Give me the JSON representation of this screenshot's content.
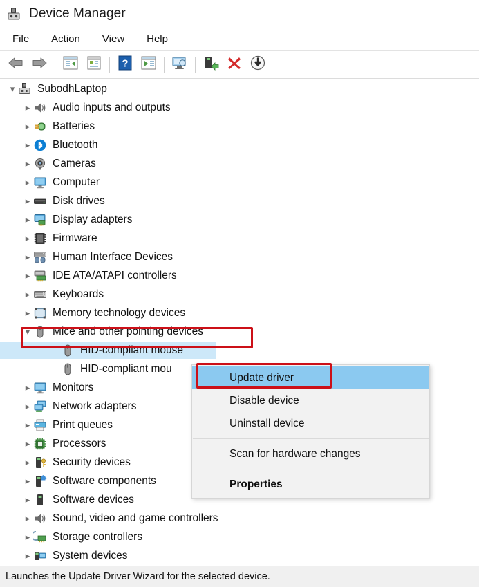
{
  "window": {
    "title": "Device Manager",
    "app_icon": "device-manager-icon"
  },
  "menubar": {
    "items": [
      {
        "label": "File",
        "name": "menu-file"
      },
      {
        "label": "Action",
        "name": "menu-action"
      },
      {
        "label": "View",
        "name": "menu-view"
      },
      {
        "label": "Help",
        "name": "menu-help"
      }
    ]
  },
  "toolbar": {
    "buttons": [
      {
        "icon": "back-arrow-icon",
        "name": "toolbar-back"
      },
      {
        "icon": "forward-arrow-icon",
        "name": "toolbar-forward"
      },
      {
        "icon": "show-hide-console-tree-icon",
        "name": "toolbar-console-tree"
      },
      {
        "icon": "properties-icon",
        "name": "toolbar-properties"
      },
      {
        "icon": "help-icon",
        "name": "toolbar-help"
      },
      {
        "icon": "show-hide-action-pane-icon",
        "name": "toolbar-action-pane"
      },
      {
        "icon": "scan-for-hardware-changes-icon",
        "name": "toolbar-scan-hardware"
      },
      {
        "icon": "update-driver-icon",
        "name": "toolbar-update-driver"
      },
      {
        "icon": "uninstall-device-icon",
        "name": "toolbar-uninstall-device"
      },
      {
        "icon": "disable-device-icon",
        "name": "toolbar-disable-device"
      }
    ]
  },
  "tree": {
    "root": {
      "label": "SubodhLaptop",
      "icon": "computer-root-icon",
      "expanded": true
    },
    "nodes": [
      {
        "label": "Audio inputs and outputs",
        "icon": "speaker-icon",
        "expanded": false,
        "level": 1
      },
      {
        "label": "Batteries",
        "icon": "battery-icon",
        "expanded": false,
        "level": 1
      },
      {
        "label": "Bluetooth",
        "icon": "bluetooth-icon",
        "expanded": false,
        "level": 1
      },
      {
        "label": "Cameras",
        "icon": "camera-icon",
        "expanded": false,
        "level": 1
      },
      {
        "label": "Computer",
        "icon": "monitor-icon",
        "expanded": false,
        "level": 1
      },
      {
        "label": "Disk drives",
        "icon": "disk-drive-icon",
        "expanded": false,
        "level": 1
      },
      {
        "label": "Display adapters",
        "icon": "display-adapter-icon",
        "expanded": false,
        "level": 1
      },
      {
        "label": "Firmware",
        "icon": "firmware-chip-icon",
        "expanded": false,
        "level": 1
      },
      {
        "label": "Human Interface Devices",
        "icon": "hid-icon",
        "expanded": false,
        "level": 1
      },
      {
        "label": "IDE ATA/ATAPI controllers",
        "icon": "ide-controller-icon",
        "expanded": false,
        "level": 1
      },
      {
        "label": "Keyboards",
        "icon": "keyboard-icon",
        "expanded": false,
        "level": 1
      },
      {
        "label": "Memory technology devices",
        "icon": "memory-technology-icon",
        "expanded": false,
        "level": 1
      },
      {
        "label": "Mice and other pointing devices",
        "icon": "mouse-icon",
        "expanded": true,
        "level": 1,
        "highlighted": true
      },
      {
        "label": "HID-compliant mouse",
        "icon": "mouse-icon",
        "level": 2,
        "selected": true
      },
      {
        "label": "HID-compliant mouse",
        "icon": "mouse-icon",
        "level": 2,
        "clipped_label": "HID-compliant mou"
      },
      {
        "label": "Monitors",
        "icon": "monitor-icon",
        "expanded": false,
        "level": 1
      },
      {
        "label": "Network adapters",
        "icon": "network-adapter-icon",
        "expanded": false,
        "level": 1
      },
      {
        "label": "Print queues",
        "icon": "printer-icon",
        "expanded": false,
        "level": 1
      },
      {
        "label": "Processors",
        "icon": "processor-icon",
        "expanded": false,
        "level": 1
      },
      {
        "label": "Security devices",
        "icon": "security-device-icon",
        "expanded": false,
        "level": 1
      },
      {
        "label": "Software components",
        "icon": "software-component-icon",
        "expanded": false,
        "level": 1
      },
      {
        "label": "Software devices",
        "icon": "software-device-icon",
        "expanded": false,
        "level": 1
      },
      {
        "label": "Sound, video and game controllers",
        "icon": "speaker-icon",
        "expanded": false,
        "level": 1
      },
      {
        "label": "Storage controllers",
        "icon": "storage-controller-icon",
        "expanded": false,
        "level": 1
      },
      {
        "label": "System devices",
        "icon": "system-device-icon",
        "expanded": false,
        "level": 1
      }
    ]
  },
  "context_menu": {
    "items": [
      {
        "label": "Update driver",
        "highlighted": true,
        "bold": false
      },
      {
        "label": "Disable device",
        "highlighted": false,
        "bold": false
      },
      {
        "label": "Uninstall device",
        "highlighted": false,
        "bold": false
      },
      {
        "separator": true
      },
      {
        "label": "Scan for hardware changes",
        "highlighted": false,
        "bold": false
      },
      {
        "separator": true
      },
      {
        "label": "Properties",
        "highlighted": false,
        "bold": true
      }
    ]
  },
  "annotations": {
    "box_color": "#cc1018",
    "boxes": [
      {
        "name": "mice-category-highlight"
      },
      {
        "name": "update-driver-highlight"
      }
    ]
  },
  "statusbar": {
    "text": "Launches the Update Driver Wizard for the selected device."
  },
  "colors": {
    "selection": "#cde8f9",
    "menu_highlight": "#8bc9f0",
    "menu_bg": "#f2f2f2",
    "statusbar_bg": "#f0f0f0"
  }
}
